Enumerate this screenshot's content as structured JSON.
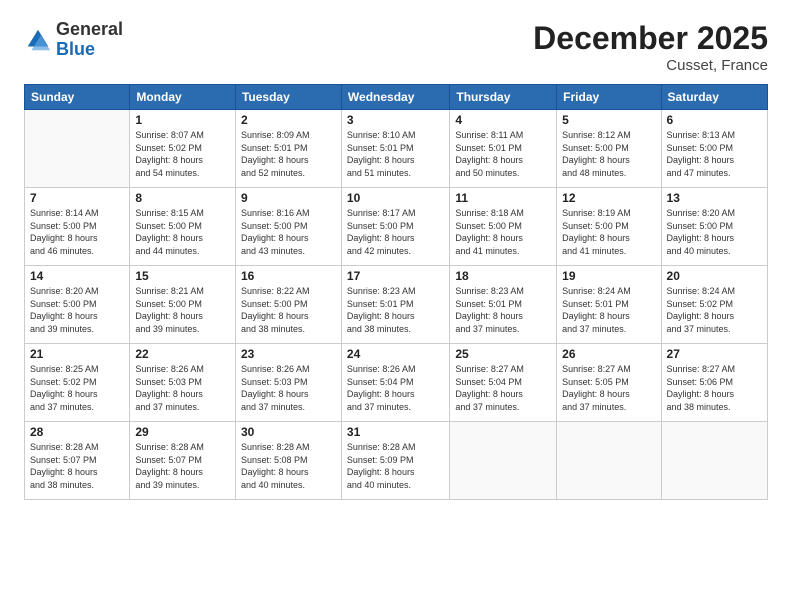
{
  "header": {
    "logo": {
      "general": "General",
      "blue": "Blue"
    },
    "title": "December 2025",
    "location": "Cusset, France"
  },
  "calendar": {
    "days_of_week": [
      "Sunday",
      "Monday",
      "Tuesday",
      "Wednesday",
      "Thursday",
      "Friday",
      "Saturday"
    ],
    "weeks": [
      [
        {
          "day": "",
          "info": ""
        },
        {
          "day": "1",
          "info": "Sunrise: 8:07 AM\nSunset: 5:02 PM\nDaylight: 8 hours\nand 54 minutes."
        },
        {
          "day": "2",
          "info": "Sunrise: 8:09 AM\nSunset: 5:01 PM\nDaylight: 8 hours\nand 52 minutes."
        },
        {
          "day": "3",
          "info": "Sunrise: 8:10 AM\nSunset: 5:01 PM\nDaylight: 8 hours\nand 51 minutes."
        },
        {
          "day": "4",
          "info": "Sunrise: 8:11 AM\nSunset: 5:01 PM\nDaylight: 8 hours\nand 50 minutes."
        },
        {
          "day": "5",
          "info": "Sunrise: 8:12 AM\nSunset: 5:00 PM\nDaylight: 8 hours\nand 48 minutes."
        },
        {
          "day": "6",
          "info": "Sunrise: 8:13 AM\nSunset: 5:00 PM\nDaylight: 8 hours\nand 47 minutes."
        }
      ],
      [
        {
          "day": "7",
          "info": "Sunrise: 8:14 AM\nSunset: 5:00 PM\nDaylight: 8 hours\nand 46 minutes."
        },
        {
          "day": "8",
          "info": "Sunrise: 8:15 AM\nSunset: 5:00 PM\nDaylight: 8 hours\nand 44 minutes."
        },
        {
          "day": "9",
          "info": "Sunrise: 8:16 AM\nSunset: 5:00 PM\nDaylight: 8 hours\nand 43 minutes."
        },
        {
          "day": "10",
          "info": "Sunrise: 8:17 AM\nSunset: 5:00 PM\nDaylight: 8 hours\nand 42 minutes."
        },
        {
          "day": "11",
          "info": "Sunrise: 8:18 AM\nSunset: 5:00 PM\nDaylight: 8 hours\nand 41 minutes."
        },
        {
          "day": "12",
          "info": "Sunrise: 8:19 AM\nSunset: 5:00 PM\nDaylight: 8 hours\nand 41 minutes."
        },
        {
          "day": "13",
          "info": "Sunrise: 8:20 AM\nSunset: 5:00 PM\nDaylight: 8 hours\nand 40 minutes."
        }
      ],
      [
        {
          "day": "14",
          "info": "Sunrise: 8:20 AM\nSunset: 5:00 PM\nDaylight: 8 hours\nand 39 minutes."
        },
        {
          "day": "15",
          "info": "Sunrise: 8:21 AM\nSunset: 5:00 PM\nDaylight: 8 hours\nand 39 minutes."
        },
        {
          "day": "16",
          "info": "Sunrise: 8:22 AM\nSunset: 5:00 PM\nDaylight: 8 hours\nand 38 minutes."
        },
        {
          "day": "17",
          "info": "Sunrise: 8:23 AM\nSunset: 5:01 PM\nDaylight: 8 hours\nand 38 minutes."
        },
        {
          "day": "18",
          "info": "Sunrise: 8:23 AM\nSunset: 5:01 PM\nDaylight: 8 hours\nand 37 minutes."
        },
        {
          "day": "19",
          "info": "Sunrise: 8:24 AM\nSunset: 5:01 PM\nDaylight: 8 hours\nand 37 minutes."
        },
        {
          "day": "20",
          "info": "Sunrise: 8:24 AM\nSunset: 5:02 PM\nDaylight: 8 hours\nand 37 minutes."
        }
      ],
      [
        {
          "day": "21",
          "info": "Sunrise: 8:25 AM\nSunset: 5:02 PM\nDaylight: 8 hours\nand 37 minutes."
        },
        {
          "day": "22",
          "info": "Sunrise: 8:26 AM\nSunset: 5:03 PM\nDaylight: 8 hours\nand 37 minutes."
        },
        {
          "day": "23",
          "info": "Sunrise: 8:26 AM\nSunset: 5:03 PM\nDaylight: 8 hours\nand 37 minutes."
        },
        {
          "day": "24",
          "info": "Sunrise: 8:26 AM\nSunset: 5:04 PM\nDaylight: 8 hours\nand 37 minutes."
        },
        {
          "day": "25",
          "info": "Sunrise: 8:27 AM\nSunset: 5:04 PM\nDaylight: 8 hours\nand 37 minutes."
        },
        {
          "day": "26",
          "info": "Sunrise: 8:27 AM\nSunset: 5:05 PM\nDaylight: 8 hours\nand 37 minutes."
        },
        {
          "day": "27",
          "info": "Sunrise: 8:27 AM\nSunset: 5:06 PM\nDaylight: 8 hours\nand 38 minutes."
        }
      ],
      [
        {
          "day": "28",
          "info": "Sunrise: 8:28 AM\nSunset: 5:07 PM\nDaylight: 8 hours\nand 38 minutes."
        },
        {
          "day": "29",
          "info": "Sunrise: 8:28 AM\nSunset: 5:07 PM\nDaylight: 8 hours\nand 39 minutes."
        },
        {
          "day": "30",
          "info": "Sunrise: 8:28 AM\nSunset: 5:08 PM\nDaylight: 8 hours\nand 40 minutes."
        },
        {
          "day": "31",
          "info": "Sunrise: 8:28 AM\nSunset: 5:09 PM\nDaylight: 8 hours\nand 40 minutes."
        },
        {
          "day": "",
          "info": ""
        },
        {
          "day": "",
          "info": ""
        },
        {
          "day": "",
          "info": ""
        }
      ]
    ]
  }
}
